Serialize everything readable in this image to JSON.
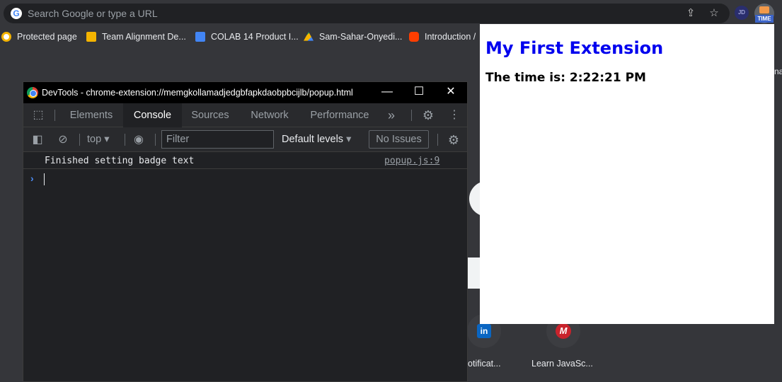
{
  "omnibox": {
    "placeholder": "Search Google or type a URL",
    "google_glyph": "G"
  },
  "extensions": {
    "jd_label": "JD",
    "time_badge": "TIME"
  },
  "bookmarks": [
    {
      "label": "Protected page",
      "icon": "protected-page-icon",
      "color": "#f4b400"
    },
    {
      "label": "Team Alignment De...",
      "icon": "slides-icon",
      "color": "#f4b400"
    },
    {
      "label": "COLAB 14 Product I...",
      "icon": "docs-icon",
      "color": "#4285f4"
    },
    {
      "label": "Sam-Sahar-Onyedi...",
      "icon": "drive-icon",
      "color": "#0f9d58"
    },
    {
      "label": "Introduction /",
      "icon": "svelte-icon",
      "color": "#ff3e00"
    }
  ],
  "popup": {
    "title": "My First Extension",
    "time_text": "The time is: 2:22:21 PM"
  },
  "devtools": {
    "title": "DevTools - chrome-extension://memgkollamadjedgbfapkdaobpbcijlb/popup.html",
    "tabs": [
      "Elements",
      "Console",
      "Sources",
      "Network",
      "Performance"
    ],
    "active_tab": "Console",
    "more_tabs": "»",
    "toolbar": {
      "context": "top",
      "filter_placeholder": "Filter",
      "levels": "Default levels",
      "issues": "No Issues"
    },
    "log": {
      "message": "Finished setting badge text",
      "source": "popup.js:9"
    },
    "prompt_glyph": "›"
  },
  "page": {
    "right_edge_text": "na",
    "tiles": [
      {
        "label": "Notificat...",
        "logo": "in"
      },
      {
        "label": "Learn JavaSc...",
        "logo": "M"
      }
    ]
  }
}
